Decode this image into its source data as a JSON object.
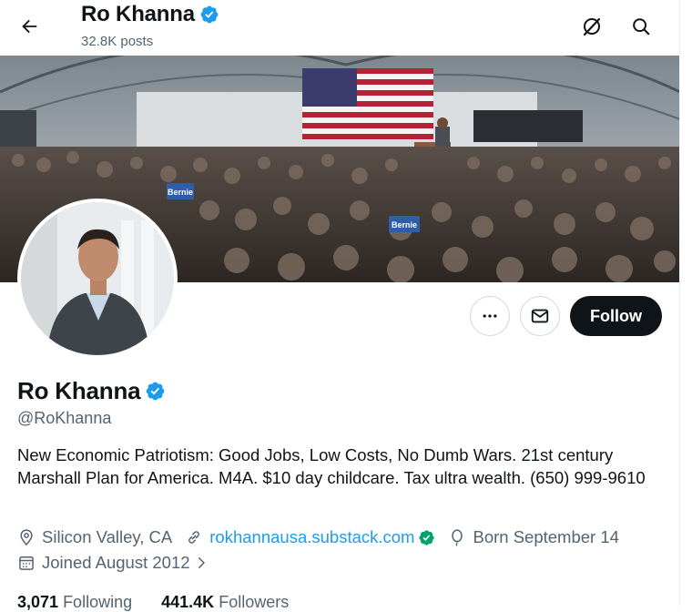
{
  "header": {
    "name": "Ro Khanna",
    "posts": "32.8K posts",
    "back_icon": "arrow-left-icon",
    "grok_icon": "grok-icon",
    "search_icon": "search-icon"
  },
  "banner": {
    "sign_1": "Bernie",
    "sign_2": "Bernie"
  },
  "profile": {
    "name": "Ro Khanna",
    "handle": "@RoKhanna",
    "bio": "New Economic Patriotism: Good Jobs, Low Costs, No Dumb Wars. 21st century Marshall Plan for America. M4A. $10 day childcare. Tax ultra wealth. (650) 999-9610",
    "location": "Silicon Valley, CA",
    "website": "rokhannausa.substack.com",
    "born": "Born September 14",
    "joined": "Joined August 2012",
    "following_count": "3,071",
    "following_label": "Following",
    "followers_count": "441.4K",
    "followers_label": "Followers"
  },
  "actions": {
    "more_icon": "more-icon",
    "message_icon": "envelope-icon",
    "follow_label": "Follow"
  },
  "colors": {
    "accent": "#1d9bf0",
    "verified": "#1d9bf0",
    "text": "#0f1419",
    "muted": "#536471",
    "button_dark": "#0f1419"
  }
}
